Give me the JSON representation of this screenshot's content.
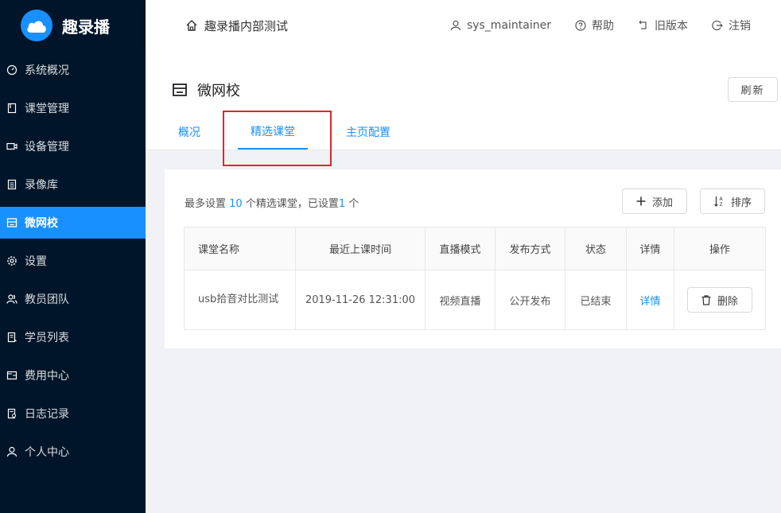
{
  "app": {
    "name": "趣录播"
  },
  "header": {
    "title": "趣录播内部测试",
    "user": "sys_maintainer",
    "help": "帮助",
    "old_version": "旧版本",
    "logout": "注销"
  },
  "sidebar": {
    "items": [
      {
        "label": "系统概况",
        "icon": "dashboard-icon"
      },
      {
        "label": "课堂管理",
        "icon": "book-icon"
      },
      {
        "label": "设备管理",
        "icon": "camera-icon"
      },
      {
        "label": "录像库",
        "icon": "library-icon"
      },
      {
        "label": "微网校",
        "icon": "shop-icon",
        "active": true
      },
      {
        "label": "设置",
        "icon": "gear-icon"
      },
      {
        "label": "教员团队",
        "icon": "team-icon"
      },
      {
        "label": "学员列表",
        "icon": "list-icon"
      },
      {
        "label": "费用中心",
        "icon": "wallet-icon"
      },
      {
        "label": "日志记录",
        "icon": "log-icon"
      },
      {
        "label": "个人中心",
        "icon": "user-icon"
      }
    ]
  },
  "page": {
    "title": "微网校",
    "refresh": "刷新",
    "tabs": [
      {
        "label": "概况"
      },
      {
        "label": "精选课堂",
        "active": true
      },
      {
        "label": "主页配置"
      }
    ]
  },
  "featured": {
    "text_pre": "最多设置",
    "max": "10",
    "text_mid": "个精选课堂，已设置",
    "count": "1",
    "text_post": "个",
    "add_label": "添加",
    "sort_label": "排序"
  },
  "table": {
    "headers": [
      "课堂名称",
      "最近上课时间",
      "直播模式",
      "发布方式",
      "状态",
      "详情",
      "操作"
    ],
    "rows": [
      {
        "name": "usb拾音对比测试",
        "time": "2019-11-26 12:31:00",
        "mode": "视频直播",
        "publish": "公开发布",
        "status": "已结束",
        "detail": "详情",
        "action": "删除"
      }
    ]
  },
  "colors": {
    "primary": "#1890ff",
    "sidebar": "#001529",
    "highlight": "#e0262f"
  }
}
